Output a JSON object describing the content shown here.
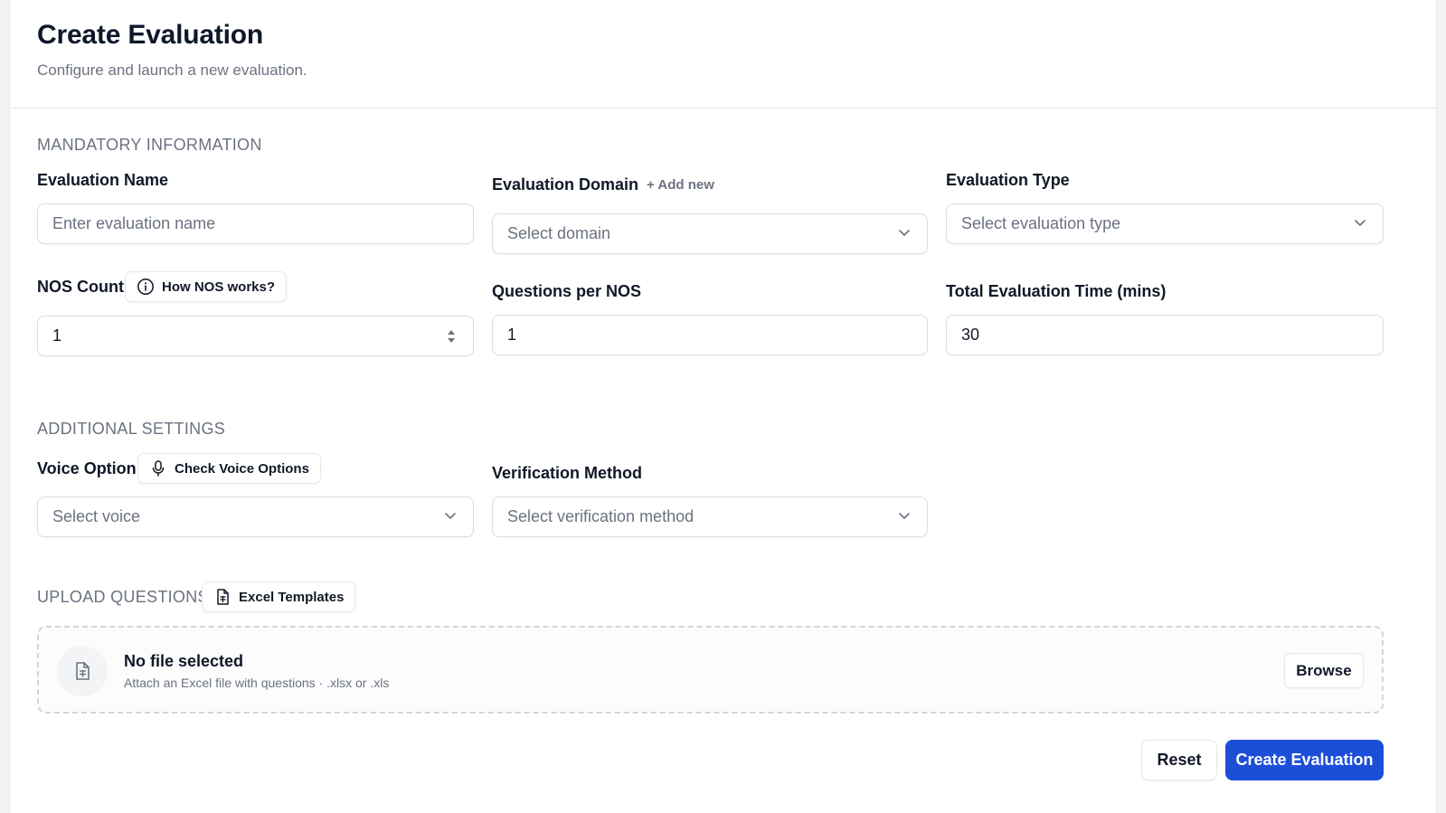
{
  "header": {
    "title": "Create Evaluation",
    "subtitle": "Configure and launch a new evaluation."
  },
  "mandatory": {
    "section_title": "MANDATORY INFORMATION",
    "evaluation_name": {
      "label": "Evaluation Name",
      "placeholder": "Enter evaluation name",
      "value": ""
    },
    "evaluation_domain": {
      "label": "Evaluation Domain",
      "add_new": "+ Add new",
      "placeholder": "Select domain"
    },
    "evaluation_type": {
      "label": "Evaluation Type",
      "placeholder": "Select evaluation type"
    },
    "nos_count": {
      "label": "NOS Count",
      "help_button": "How NOS works?",
      "value": "1"
    },
    "questions_per_nos": {
      "label": "Questions per NOS",
      "value": "1"
    },
    "total_time": {
      "label": "Total Evaluation Time (mins)",
      "value": "30"
    }
  },
  "additional": {
    "section_title": "ADDITIONAL SETTINGS",
    "voice_option": {
      "label": "Voice Option",
      "help_button": "Check Voice Options",
      "placeholder": "Select voice"
    },
    "verification_method": {
      "label": "Verification Method",
      "placeholder": "Select verification method"
    }
  },
  "upload": {
    "section_title": "UPLOAD QUESTIONS",
    "templates_button": "Excel Templates",
    "file_title": "No file selected",
    "file_desc": "Attach an Excel file with questions · .xlsx or .xls",
    "browse_label": "Browse"
  },
  "footer": {
    "reset_label": "Reset",
    "create_label": "Create Evaluation"
  },
  "colors": {
    "primary": "#1d4ed8",
    "muted_text": "#6b7280",
    "border": "#d9dde3"
  },
  "icons": [
    "info-icon",
    "microphone-icon",
    "file-spreadsheet-icon",
    "chevron-down-icon",
    "stepper-icon",
    "file-icon"
  ]
}
